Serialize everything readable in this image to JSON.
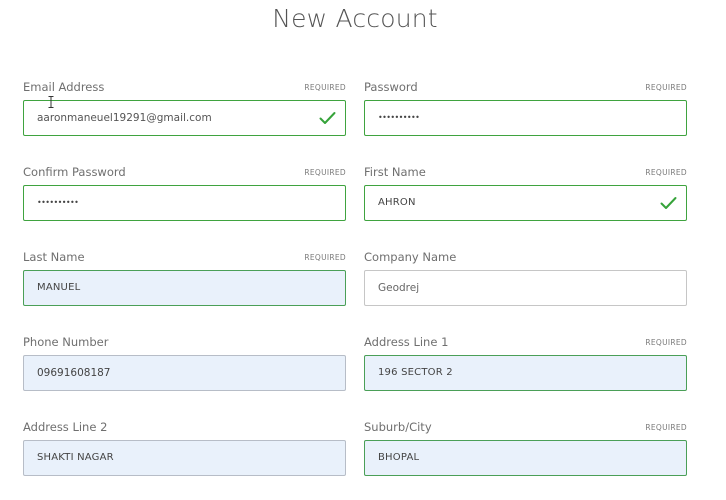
{
  "page": {
    "title": "New Account"
  },
  "form": {
    "email": {
      "label": "Email Address",
      "required": "REQUIRED",
      "value": "aaronmaneuel19291@gmail.com"
    },
    "password": {
      "label": "Password",
      "required": "REQUIRED",
      "value": "••••••••••"
    },
    "confirm_password": {
      "label": "Confirm Password",
      "required": "REQUIRED",
      "value": "••••••••••"
    },
    "first_name": {
      "label": "First Name",
      "required": "REQUIRED",
      "value": "AHRON"
    },
    "last_name": {
      "label": "Last Name",
      "required": "REQUIRED",
      "value": "MANUEL"
    },
    "company_name": {
      "label": "Company Name",
      "value": "Geodrej"
    },
    "phone_number": {
      "label": "Phone Number",
      "value": "09691608187"
    },
    "address_line_1": {
      "label": "Address Line 1",
      "required": "REQUIRED",
      "value": "196 SECTOR 2"
    },
    "address_line_2": {
      "label": "Address Line 2",
      "value": "SHAKTI NAGAR"
    },
    "suburb_city": {
      "label": "Suburb/City",
      "required": "REQUIRED",
      "value": "BHOPAL"
    }
  },
  "icons": {
    "valid": "check-icon",
    "cursor": "text-cursor-icon"
  },
  "colors": {
    "valid_border": "#3fa33f",
    "autofill_background": "#e9f1fb",
    "default_border": "#c6c6c6"
  }
}
